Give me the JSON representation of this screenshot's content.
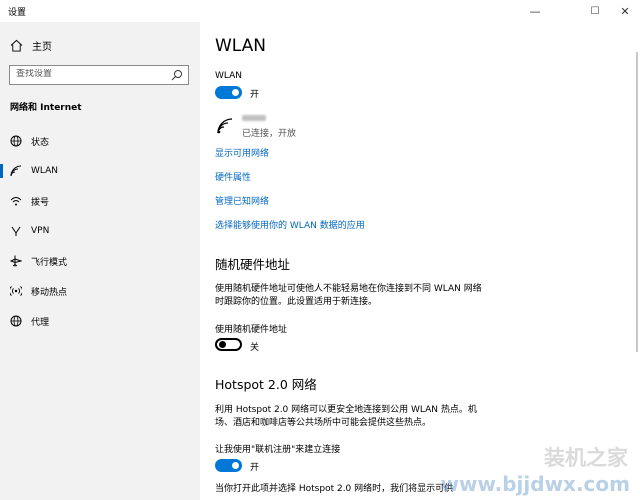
{
  "window": {
    "title": "设置",
    "controls": {
      "minimize": "—",
      "maximize": "☐",
      "close": "✕"
    }
  },
  "sidebar": {
    "home_label": "主页",
    "search_placeholder": "查找设置",
    "section_title": "网络和 Internet",
    "items": [
      {
        "label": "状态",
        "icon": "globe-icon"
      },
      {
        "label": "WLAN",
        "icon": "wifi-icon"
      },
      {
        "label": "拨号",
        "icon": "dialup-icon"
      },
      {
        "label": "VPN",
        "icon": "vpn-icon"
      },
      {
        "label": "飞行模式",
        "icon": "airplane-icon"
      },
      {
        "label": "移动热点",
        "icon": "hotspot-icon"
      },
      {
        "label": "代理",
        "icon": "globe-icon"
      }
    ],
    "active_index": 1
  },
  "main": {
    "page_title": "WLAN",
    "wlan_label": "WLAN",
    "wlan_toggle": {
      "on": true,
      "text": "开"
    },
    "network": {
      "status": "已连接，开放"
    },
    "links": [
      "显示可用网络",
      "硬件属性",
      "管理已知网络",
      "选择能够使用你的 WLAN 数据的应用"
    ],
    "random_hw": {
      "heading": "随机硬件地址",
      "description": "使用随机硬件地址可使他人不能轻易地在你连接到不同 WLAN 网络时跟踪你的位置。此设置适用于新连接。",
      "toggle_label": "使用随机硬件地址",
      "toggle": {
        "on": false,
        "text": "关"
      }
    },
    "hotspot": {
      "heading": "Hotspot 2.0 网络",
      "description": "利用 Hotspot 2.0 网络可以更安全地连接到公用 WLAN 热点。机场、酒店和咖啡店等公共场所中可能会提供这些热点。",
      "toggle_label": "让我使用\"联机注册\"来建立连接",
      "toggle": {
        "on": true,
        "text": "开"
      },
      "footer": "当你打开此项并选择 Hotspot 2.0 网络时，我们将显示可供"
    }
  },
  "watermark": {
    "text1": "装机之家",
    "text2": "www.bjjdwx.com"
  },
  "colors": {
    "accent": "#0078d7",
    "link": "#0067c0",
    "sidebar_bg": "#f2f2f2"
  }
}
